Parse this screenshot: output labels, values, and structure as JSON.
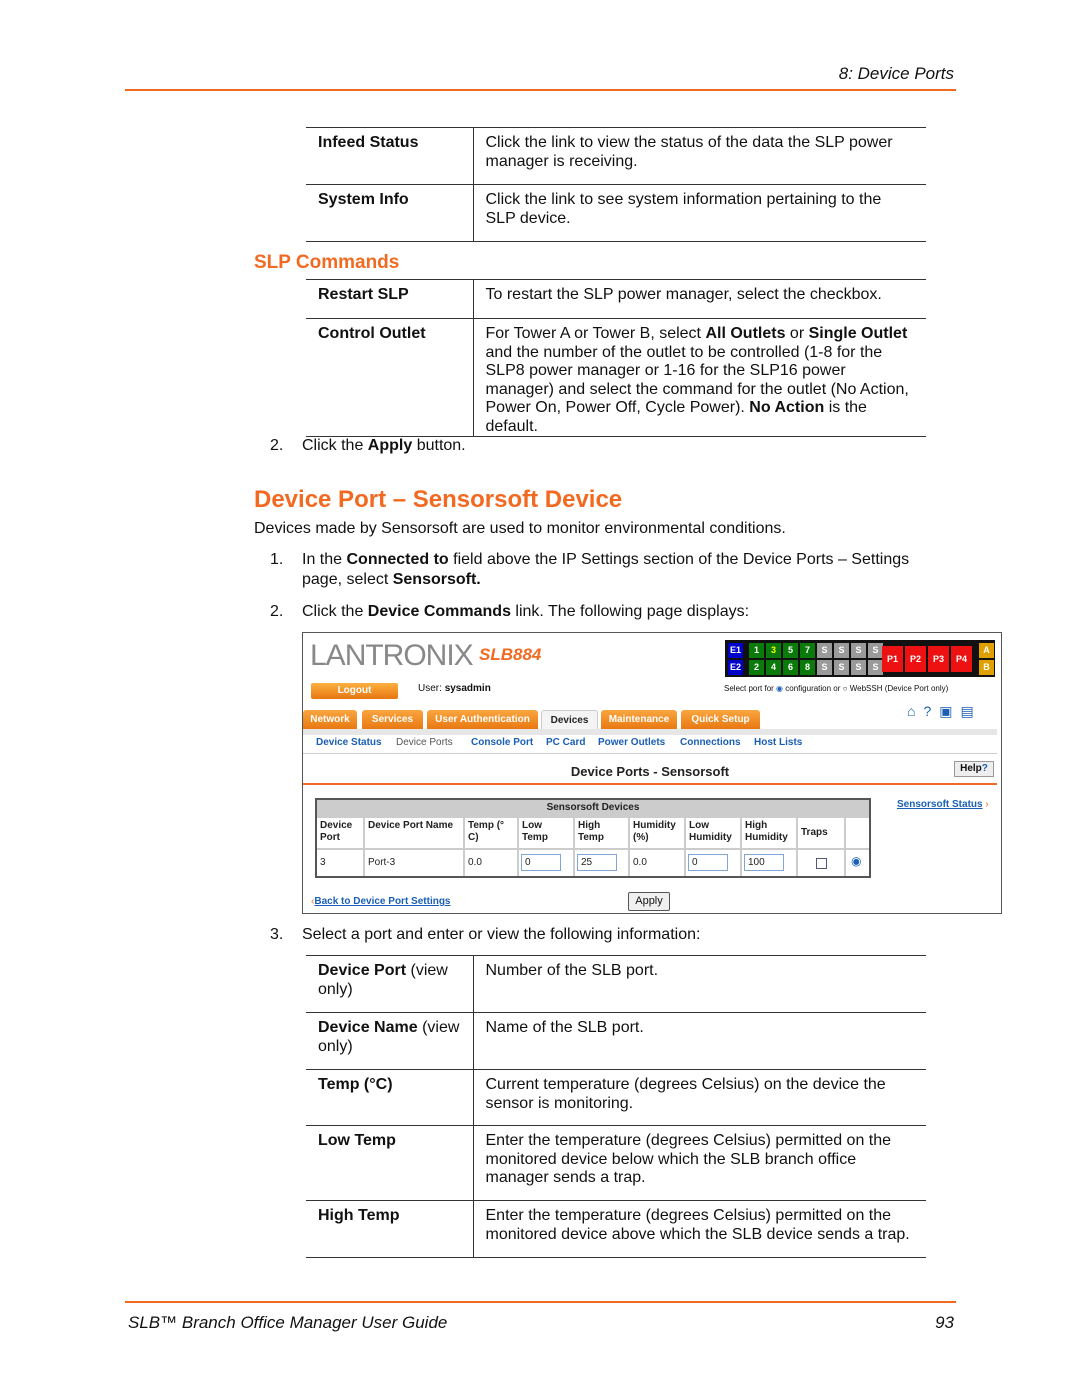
{
  "header": {
    "chapter": "8: Device Ports"
  },
  "table1": [
    {
      "term": "Infeed Status",
      "desc": "Click the link to view the status of the data the SLP power manager is receiving."
    },
    {
      "term": "System Info",
      "desc": "Click the link to see system information pertaining to the SLP device."
    }
  ],
  "slp_heading": "SLP Commands",
  "table2": [
    {
      "term": "Restart SLP",
      "desc": "To restart the SLP power manager, select the checkbox."
    },
    {
      "term": "Control Outlet",
      "desc_parts": [
        "For Tower A or Tower B, select ",
        "All Outlets",
        " or ",
        "Single Outlet",
        " and the number of the outlet to be controlled (1-8 for the SLP8 power manager or 1-16 for the SLP16 power manager) and select the command for the outlet (No Action, Power On, Power Off, Cycle Power). ",
        "No Action",
        " is the default."
      ]
    }
  ],
  "step_apply": {
    "num": "2.",
    "pre": "Click the ",
    "bold": "Apply",
    "post": " button."
  },
  "section_title": "Device Port – Sensorsoft Device",
  "intro": "Devices made by Sensorsoft are used to monitor environmental conditions.",
  "steps": [
    {
      "num": "1.",
      "parts": [
        "In the ",
        "Connected to",
        " field above the IP Settings section of the Device Ports – Settings page, select ",
        "Sensorsoft."
      ]
    },
    {
      "num": "2.",
      "parts": [
        "Click the ",
        "Device Commands",
        " link. The following page displays:"
      ]
    },
    {
      "num": "3.",
      "text": "Select a port and enter or view the following information:"
    }
  ],
  "screenshot": {
    "logo": "LANTRONIX",
    "model": "SLB884",
    "ports_top": [
      "E1",
      "1",
      "3",
      "5",
      "7",
      "S",
      "S",
      "S",
      "S"
    ],
    "ports_bottom": [
      "E2",
      "2",
      "4",
      "6",
      "8",
      "S",
      "S",
      "S",
      "S"
    ],
    "power": [
      "P1",
      "P2",
      "P3",
      "P4"
    ],
    "ab": [
      "A",
      "B"
    ],
    "logout": "Logout",
    "user_label": "User:",
    "user": "sysadmin",
    "select_port": "Select port for",
    "opt_config": "configuration or",
    "opt_webssh": "WebSSH (Device Port only)",
    "tabs": [
      "Network",
      "Services",
      "User Authentication",
      "Devices",
      "Maintenance",
      "Quick Setup"
    ],
    "subnav": [
      "Device Status",
      "Device Ports",
      "Console Port",
      "PC Card",
      "Power Outlets",
      "Connections",
      "Host Lists"
    ],
    "page_title": "Device Ports - Sensorsoft",
    "help": "Help",
    "sensorsoft_status": "Sensorsoft Status",
    "table_title": "Sensorsoft Devices",
    "columns": [
      "Device Port",
      "Device Port Name",
      "Temp (° C)",
      "Low Temp",
      "High Temp",
      "Humidity (%)",
      "Low Humidity",
      "High Humidity",
      "Traps"
    ],
    "row": {
      "port": "3",
      "name": "Port-3",
      "temp": "0.0",
      "low_temp": "0",
      "high_temp": "25",
      "humidity": "0.0",
      "low_humidity": "0",
      "high_humidity": "100",
      "traps": false,
      "selected": true
    },
    "back_link": "Back to Device Port Settings",
    "apply": "Apply",
    "colors": {
      "orange": "#f26a21",
      "green": "#0a7a0a",
      "blue": "#0000cc",
      "red": "#ee1111",
      "gray": "#9a9a9a",
      "amber": "#e0a000"
    }
  },
  "table3": [
    {
      "term": "Device Port",
      "term_note": " (view only)",
      "desc": "Number of the SLB port."
    },
    {
      "term": "Device Name",
      "term_note": " (view only)",
      "desc": "Name of the SLB port."
    },
    {
      "term": "Temp (°C)",
      "term_note": "",
      "desc": "Current temperature (degrees Celsius) on the device the sensor is monitoring."
    },
    {
      "term": "Low Temp",
      "term_note": "",
      "desc": "Enter the temperature (degrees Celsius) permitted on the monitored device below which the SLB branch office manager sends a trap."
    },
    {
      "term": "High Temp",
      "term_note": "",
      "desc": "Enter the temperature (degrees Celsius) permitted on the monitored device above which the SLB device sends a trap."
    }
  ],
  "footer": {
    "title": "SLB™ Branch Office Manager User Guide",
    "page": "93"
  }
}
